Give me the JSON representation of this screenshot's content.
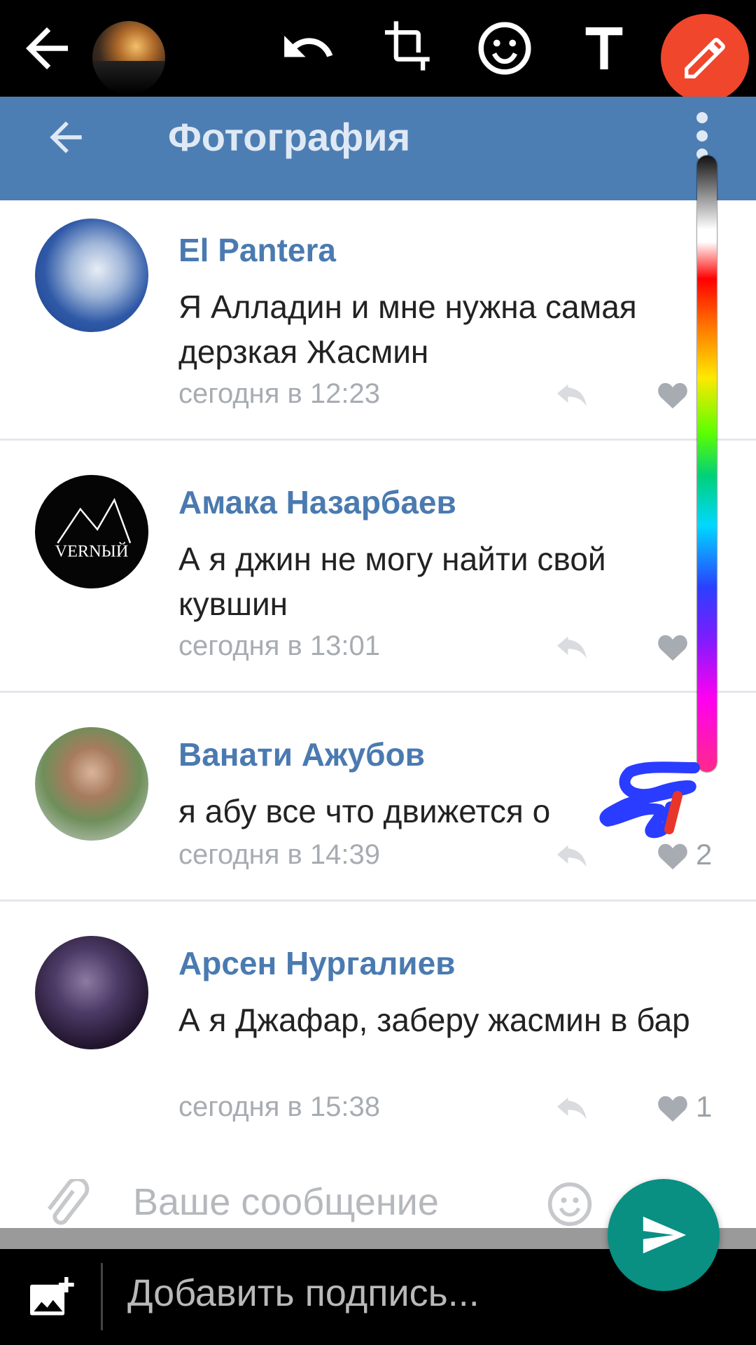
{
  "editor": {
    "caption_placeholder": "Добавить подпись..."
  },
  "app": {
    "title": "Фотография",
    "composer_placeholder": "Ваше сообщение"
  },
  "comments": [
    {
      "name": "El Pantera",
      "text": "Я Алладин и мне нужна самая дерзкая Жасмин",
      "time": "сегодня в 12:23",
      "likes": ""
    },
    {
      "name": "Амака Назарбаев",
      "text": "А я джин не могу найти свой кувшин",
      "time": "сегодня в 13:01",
      "likes": "",
      "avatar_text": "VERNЫЙ"
    },
    {
      "name": "Ванати Ажубов",
      "text": "я абу все что движется о",
      "time": "сегодня в 14:39",
      "likes": "2"
    },
    {
      "name": "Арсен Нургалиев",
      "text": "А я Джафар, заберу жасмин в бар",
      "time": "сегодня в 15:38",
      "likes": "1"
    }
  ],
  "colors": {
    "accent_pen": "#f0462c",
    "vk_header": "#4d7eb3",
    "send_button": "#0a8f83",
    "drawing_blue": "#2a3cff",
    "drawing_red": "#e8362a"
  },
  "icons": [
    "back-arrow-icon",
    "undo-icon",
    "crop-rotate-icon",
    "emoji-icon",
    "text-icon",
    "pencil-icon",
    "add-photo-icon",
    "send-icon",
    "paperclip-icon",
    "reply-icon",
    "heart-icon",
    "more-vert-icon"
  ]
}
